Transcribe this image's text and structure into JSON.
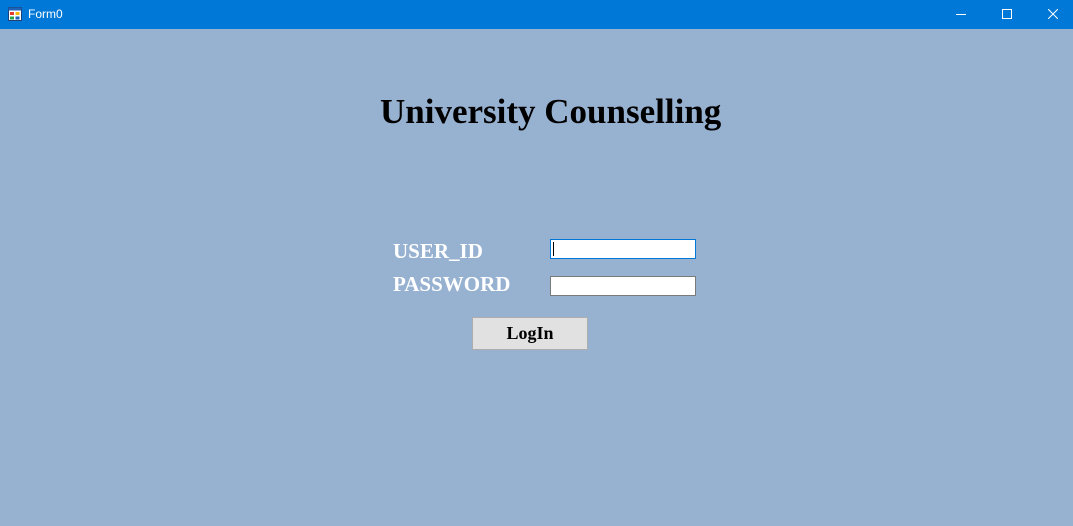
{
  "window": {
    "title": "Form0",
    "app_icon": "form-icon",
    "controls": {
      "minimize_icon": "minimize-icon",
      "maximize_icon": "maximize-icon",
      "close_icon": "close-icon"
    },
    "titlebar_color": "#0078d7",
    "background_color": "#97b1d1"
  },
  "form": {
    "heading": "University Counselling",
    "user_id_label": "USER_ID",
    "user_id_value": "",
    "password_label": "PASSWORD",
    "password_value": "",
    "login_label": "LogIn"
  }
}
